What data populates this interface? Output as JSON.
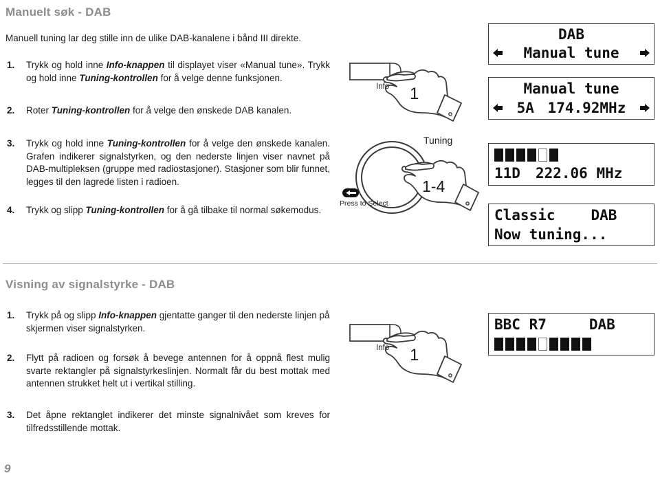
{
  "document": {
    "page_number": "9"
  },
  "sections": [
    {
      "title": "Manuelt søk - DAB",
      "intro": "Manuell tuning lar deg stille inn de ulike DAB-kanalene i bånd III direkte.",
      "steps": [
        {
          "number": "1.",
          "parts": [
            {
              "text": "Trykk og hold inne ",
              "bold": false
            },
            {
              "text": "Info-knappen",
              "bold": true
            },
            {
              "text": " til displayet viser «Manual tune». Trykk og hold inne ",
              "bold": false
            },
            {
              "text": "Tuning-kontrollen",
              "bold": true
            },
            {
              "text": " for å velge denne funksjonen.",
              "bold": false
            }
          ]
        },
        {
          "number": "2.",
          "parts": [
            {
              "text": "Roter ",
              "bold": false
            },
            {
              "text": "Tuning-kontrollen",
              "bold": true
            },
            {
              "text": " for å velge den ønskede DAB kanalen.",
              "bold": false
            }
          ]
        },
        {
          "number": "3.",
          "parts": [
            {
              "text": "Trykk og hold inne ",
              "bold": false
            },
            {
              "text": "Tuning-kontrollen",
              "bold": true
            },
            {
              "text": " for å velge den ønskede kanalen. Grafen indikerer signalstyrken, og den nederste linjen viser navnet på DAB-multipleksen (gruppe med radiostasjoner). Stasjoner som blir funnet, legges til den lagrede listen i radioen.",
              "bold": false
            }
          ]
        },
        {
          "number": "4.",
          "parts": [
            {
              "text": "Trykk og slipp ",
              "bold": false
            },
            {
              "text": "Tuning-kontrollen",
              "bold": true
            },
            {
              "text": " for å gå tilbake til normal søkemodus.",
              "bold": false
            }
          ]
        }
      ]
    },
    {
      "title": "Visning av signalstyrke - DAB",
      "steps": [
        {
          "number": "1.",
          "parts": [
            {
              "text": "Trykk på og slipp ",
              "bold": false
            },
            {
              "text": "Info-knappen",
              "bold": true
            },
            {
              "text": " gjentatte ganger til den nederste linjen på skjermen viser signalstyrken.",
              "bold": false
            }
          ]
        },
        {
          "number": "2.",
          "parts": [
            {
              "text": "Flytt på radioen og forsøk å bevege antennen for å oppnå flest mulig svarte rektangler på signalstyrkeslinjen. Normalt får du best mottak med antennen strukket helt ut i vertikal stilling.",
              "bold": false
            }
          ]
        },
        {
          "number": "3.",
          "parts": [
            {
              "text": "Det åpne rektanglet indikerer det minste signalnivået som kreves for tilfredsstillende mottak.",
              "bold": false
            }
          ]
        }
      ]
    }
  ],
  "displays": [
    {
      "id": "lcd-1",
      "line1": "DAB",
      "line2": "Manual tune",
      "left_arrow": true,
      "right_arrow": true
    },
    {
      "id": "lcd-2",
      "line1": "Manual tune",
      "line2_left": "5A",
      "line2_right": "174.92MHz",
      "left_arrow": true,
      "right_arrow": true
    },
    {
      "id": "lcd-3",
      "bars": [
        "filled",
        "filled",
        "filled",
        "filled",
        "empty",
        "filled"
      ],
      "line2_left": "11D",
      "line2_right": "222.06 MHz"
    },
    {
      "id": "lcd-4",
      "line1_left": "Classic",
      "line1_right": "DAB",
      "line2": "Now tuning..."
    },
    {
      "id": "lcd-5",
      "line1_left": "BBC R7",
      "line1_right": "DAB",
      "bars": [
        "filled",
        "filled",
        "filled",
        "filled",
        "empty",
        "filled",
        "filled",
        "filled",
        "filled"
      ]
    }
  ],
  "illustrations": {
    "info_button_top": {
      "button_label": "Info",
      "hand_label": "1"
    },
    "tuning_knob": {
      "knob_label": "Tuning",
      "hand_label": "1-4",
      "press_label": "Press to Select"
    },
    "info_button_bottom": {
      "button_label": "Info",
      "hand_label": "1"
    }
  },
  "colors": {
    "heading": "#8d8d8d",
    "body": "#1b1b1b",
    "divider": "#b4b4b4",
    "lcd_border": "#3a3a3a"
  }
}
